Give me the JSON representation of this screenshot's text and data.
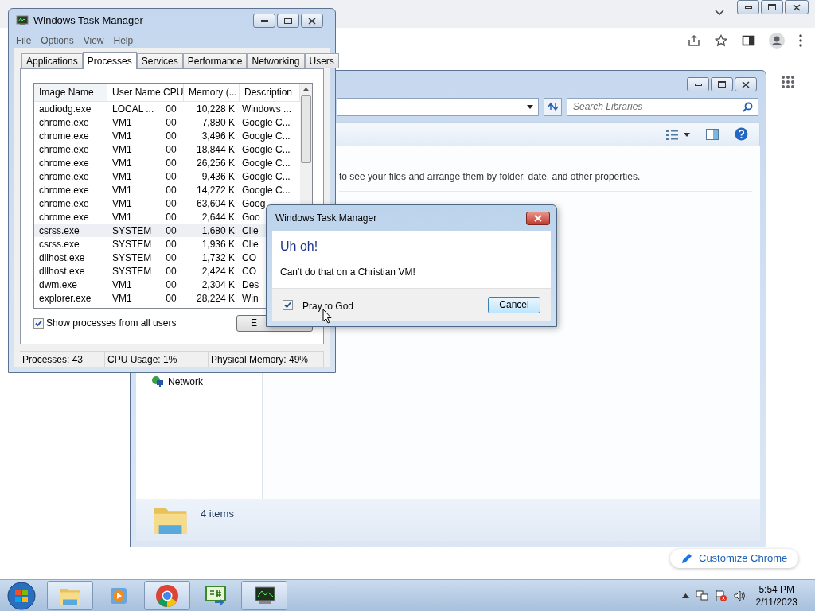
{
  "browser": {
    "customize_button": "Customize Chrome"
  },
  "explorer": {
    "search_placeholder": "Search Libraries",
    "hint": "to see your files and arrange them by folder, date, and other properties.",
    "nav_items": [
      {
        "label": "Network"
      }
    ],
    "status": "4 items"
  },
  "task_manager": {
    "title": "Windows Task Manager",
    "menu": [
      "File",
      "Options",
      "View",
      "Help"
    ],
    "tabs": [
      {
        "label": "Applications",
        "selected": false
      },
      {
        "label": "Processes",
        "selected": true
      },
      {
        "label": "Services",
        "selected": false
      },
      {
        "label": "Performance",
        "selected": false
      },
      {
        "label": "Networking",
        "selected": false
      },
      {
        "label": "Users",
        "selected": false
      }
    ],
    "columns": [
      "Image Name",
      "User Name",
      "CPU",
      "Memory (...",
      "Description"
    ],
    "rows": [
      {
        "cells": [
          "audiodg.exe",
          "LOCAL ...",
          "00",
          "10,228 K",
          "Windows ..."
        ],
        "selected": false
      },
      {
        "cells": [
          "chrome.exe",
          "VM1",
          "00",
          "7,880 K",
          "Google C..."
        ],
        "selected": false
      },
      {
        "cells": [
          "chrome.exe",
          "VM1",
          "00",
          "3,496 K",
          "Google C..."
        ],
        "selected": false
      },
      {
        "cells": [
          "chrome.exe",
          "VM1",
          "00",
          "18,844 K",
          "Google C..."
        ],
        "selected": false
      },
      {
        "cells": [
          "chrome.exe",
          "VM1",
          "00",
          "26,256 K",
          "Google C..."
        ],
        "selected": false
      },
      {
        "cells": [
          "chrome.exe",
          "VM1",
          "00",
          "9,436 K",
          "Google C..."
        ],
        "selected": false
      },
      {
        "cells": [
          "chrome.exe",
          "VM1",
          "00",
          "14,272 K",
          "Google C..."
        ],
        "selected": false
      },
      {
        "cells": [
          "chrome.exe",
          "VM1",
          "00",
          "63,604 K",
          "Goog"
        ],
        "selected": false
      },
      {
        "cells": [
          "chrome.exe",
          "VM1",
          "00",
          "2,644 K",
          "Goo"
        ],
        "selected": false
      },
      {
        "cells": [
          "csrss.exe",
          "SYSTEM",
          "00",
          "1,680 K",
          "Clie"
        ],
        "selected": true
      },
      {
        "cells": [
          "csrss.exe",
          "SYSTEM",
          "00",
          "1,936 K",
          "Clie"
        ],
        "selected": false
      },
      {
        "cells": [
          "dllhost.exe",
          "SYSTEM",
          "00",
          "1,732 K",
          "CO"
        ],
        "selected": false
      },
      {
        "cells": [
          "dllhost.exe",
          "SYSTEM",
          "00",
          "2,424 K",
          "CO"
        ],
        "selected": false
      },
      {
        "cells": [
          "dwm.exe",
          "VM1",
          "00",
          "2,304 K",
          "Des"
        ],
        "selected": false
      },
      {
        "cells": [
          "explorer.exe",
          "VM1",
          "00",
          "28,224 K",
          "Win"
        ],
        "selected": false
      }
    ],
    "show_all_users": {
      "label": "Show processes from all users",
      "checked": true
    },
    "end_button": "E",
    "status_bar": [
      "Processes: 43",
      "CPU Usage: 1%",
      "Physical Memory: 49%"
    ]
  },
  "dialog": {
    "title": "Windows Task Manager",
    "heading": "Uh oh!",
    "message": "Can't do that on a Christian VM!",
    "checkbox": {
      "label": "Pray to God",
      "checked": true
    },
    "button": "Cancel"
  },
  "taskbar": {
    "time": "5:54 PM",
    "date": "2/11/2023"
  }
}
